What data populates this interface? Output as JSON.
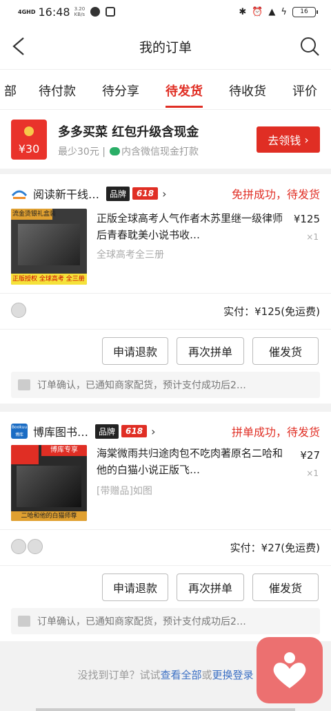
{
  "status_bar": {
    "network": "4GHD",
    "time": "16:48",
    "speed_value": "3.20",
    "speed_unit": "KB/s",
    "battery": "16"
  },
  "header": {
    "title": "我的订单"
  },
  "tabs": [
    {
      "label": "部",
      "active": false
    },
    {
      "label": "待付款",
      "active": false
    },
    {
      "label": "待分享",
      "active": false
    },
    {
      "label": "待发货",
      "active": true
    },
    {
      "label": "待收货",
      "active": false
    },
    {
      "label": "评价",
      "active": false
    }
  ],
  "promo": {
    "amount": "¥30",
    "title": "多多买菜 红包升级含现金",
    "min_spend": "最少30元",
    "note": "内含微信现金打款",
    "button": "去领钱"
  },
  "orders": [
    {
      "store": "阅读新干线…",
      "brand_badge": "品牌",
      "promo_badge": "618",
      "status": "免拼成功，待发货",
      "title": "正版全球高考人气作者木苏里继一级律师后青春耽美小说书收…",
      "spec": "全球高考全三册",
      "price": "¥125",
      "qty": "×1",
      "paid": "实付：¥125(免运费)",
      "buttons": [
        "申请退款",
        "再次拼单",
        "催发货"
      ],
      "notice": "订单确认，已通知商家配货，预计支付成功后2…",
      "image_top_label": "流金烫银礼盒装",
      "image_bottom_label": "正版授权 全球高考 全三册",
      "brand_color": "#2f7fd1"
    },
    {
      "store": "博库图书…",
      "brand_badge": "品牌",
      "promo_badge": "618",
      "status": "拼单成功，待发货",
      "title": "海棠微雨共归途肉包不吃肉著原名二哈和他的白猫小说正版飞…",
      "spec": "[带赠品]如图",
      "price": "¥27",
      "qty": "×1",
      "paid": "实付：¥27(免运费)",
      "buttons": [
        "申请退款",
        "再次拼单",
        "催发货"
      ],
      "notice": "订单确认，已通知商家配货，预计支付成功后2…",
      "store_logo_text": "Bookuu 博库",
      "image_top_label": "博库专享",
      "image_bottom_label": "二哈和他的白猫师尊",
      "brand_color": "#1a6cc4"
    }
  ],
  "footer": {
    "prefix": "没找到订单？试试",
    "link1": "查看全部",
    "middle": "或",
    "link2": "更换登录"
  }
}
